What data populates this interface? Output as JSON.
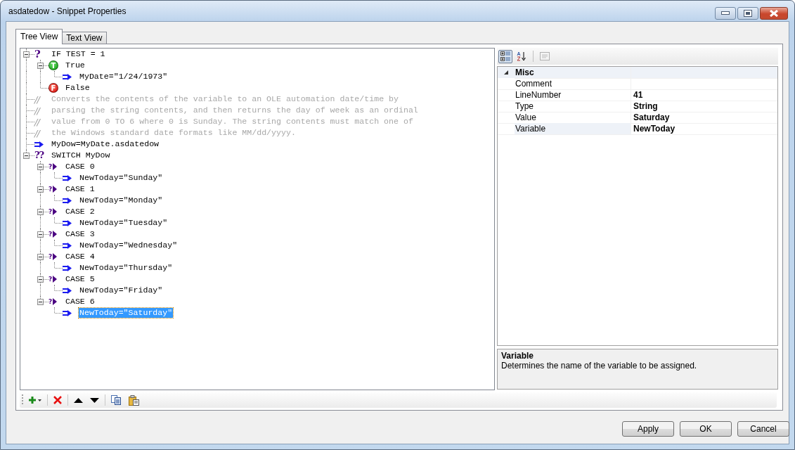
{
  "window": {
    "title": "asdatedow - Snippet Properties"
  },
  "tabs": [
    {
      "label": "Tree View",
      "selected": true
    },
    {
      "label": "Text View",
      "selected": false
    }
  ],
  "tree": [
    {
      "kind": "if",
      "icon": "?",
      "text": "IF TEST = 1",
      "selected": false,
      "expanded": true,
      "children": [
        {
          "kind": "true",
          "icon": "T",
          "text": "True",
          "selected": false,
          "expanded": true,
          "children": [
            {
              "kind": "assign",
              "text": "MyDate=\"1/24/1973\"",
              "selected": false
            }
          ]
        },
        {
          "kind": "false",
          "icon": "F",
          "text": "False",
          "selected": false
        }
      ]
    },
    {
      "kind": "comment",
      "icon": "//",
      "text": "Converts the contents of the variable to an OLE automation date/time by",
      "selected": false
    },
    {
      "kind": "comment",
      "icon": "//",
      "text": "parsing the string contents, and then returns the day of week as an ordinal",
      "selected": false
    },
    {
      "kind": "comment",
      "icon": "//",
      "text": "value from 0 TO 6 where 0 is Sunday. The string contents must match one of",
      "selected": false
    },
    {
      "kind": "comment",
      "icon": "//",
      "text": "the Windows standard date formats like MM/dd/yyyy.",
      "selected": false
    },
    {
      "kind": "assign",
      "text": "MyDow=MyDate.asdatedow",
      "selected": false
    },
    {
      "kind": "switch",
      "icon": "??",
      "text": "SWITCH MyDow",
      "selected": false,
      "expanded": true,
      "children": [
        {
          "kind": "case",
          "icon": "?",
          "text": "CASE 0",
          "selected": false,
          "expanded": true,
          "children": [
            {
              "kind": "assign",
              "text": "NewToday=\"Sunday\"",
              "selected": false
            }
          ]
        },
        {
          "kind": "case",
          "icon": "?",
          "text": "CASE 1",
          "selected": false,
          "expanded": true,
          "children": [
            {
              "kind": "assign",
              "text": "NewToday=\"Monday\"",
              "selected": false
            }
          ]
        },
        {
          "kind": "case",
          "icon": "?",
          "text": "CASE 2",
          "selected": false,
          "expanded": true,
          "children": [
            {
              "kind": "assign",
              "text": "NewToday=\"Tuesday\"",
              "selected": false
            }
          ]
        },
        {
          "kind": "case",
          "icon": "?",
          "text": "CASE 3",
          "selected": false,
          "expanded": true,
          "children": [
            {
              "kind": "assign",
              "text": "NewToday=\"Wednesday\"",
              "selected": false
            }
          ]
        },
        {
          "kind": "case",
          "icon": "?",
          "text": "CASE 4",
          "selected": false,
          "expanded": true,
          "children": [
            {
              "kind": "assign",
              "text": "NewToday=\"Thursday\"",
              "selected": false
            }
          ]
        },
        {
          "kind": "case",
          "icon": "?",
          "text": "CASE 5",
          "selected": false,
          "expanded": true,
          "children": [
            {
              "kind": "assign",
              "text": "NewToday=\"Friday\"",
              "selected": false
            }
          ]
        },
        {
          "kind": "case",
          "icon": "?",
          "text": "CASE 6",
          "selected": false,
          "expanded": true,
          "children": [
            {
              "kind": "assign",
              "text": "NewToday=\"Saturday\"",
              "selected": true
            }
          ]
        }
      ]
    }
  ],
  "property_grid": {
    "view_buttons": [
      {
        "kind": "categorized",
        "selected": true
      },
      {
        "kind": "alphabetical",
        "selected": false
      }
    ],
    "category": {
      "name": "Misc",
      "expanded": true
    },
    "properties": [
      {
        "name": "Comment",
        "selected": false
      },
      {
        "name": "LineNumber",
        "value": "41",
        "selected": false
      },
      {
        "name": "Type",
        "value": "String",
        "selected": false
      },
      {
        "name": "Value",
        "value": "Saturday",
        "selected": false
      },
      {
        "name": "Variable",
        "value": "NewToday",
        "selected": true
      }
    ],
    "description": {
      "title": "Variable",
      "text": "Determines the name of the variable to be assigned."
    }
  },
  "buttons": [
    "Apply",
    "OK",
    "Cancel"
  ]
}
